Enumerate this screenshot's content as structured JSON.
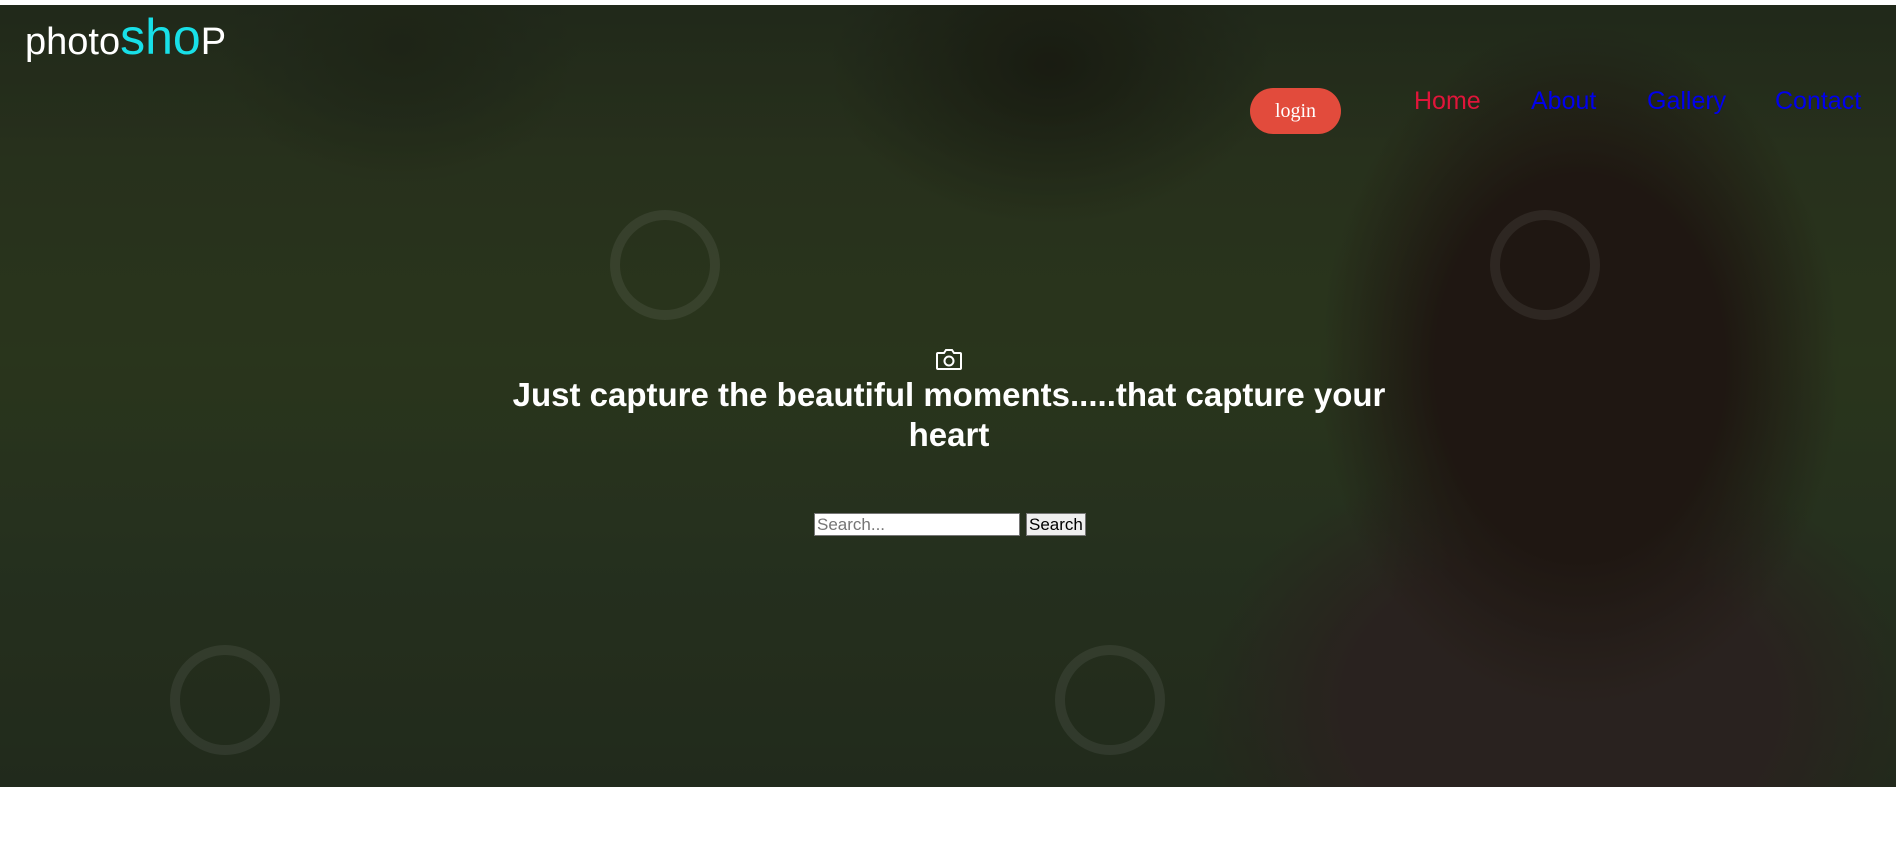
{
  "logo": {
    "part1": "photo",
    "part2": "sho",
    "part3": "P"
  },
  "header": {
    "login_label": "login"
  },
  "nav": {
    "items": [
      {
        "label": "Home"
      },
      {
        "label": "About"
      },
      {
        "label": "Gallery"
      },
      {
        "label": "Contact"
      }
    ]
  },
  "hero": {
    "icon": "camera-icon",
    "headline": "Just capture the beautiful moments.....that capture your heart"
  },
  "search": {
    "placeholder": "Search...",
    "value": "",
    "button_label": "Search"
  },
  "colors": {
    "login_bg": "#e24b3c",
    "logo_accent": "#18e0e8",
    "nav_active": "#e0153a",
    "nav_link": "#0000ee"
  }
}
